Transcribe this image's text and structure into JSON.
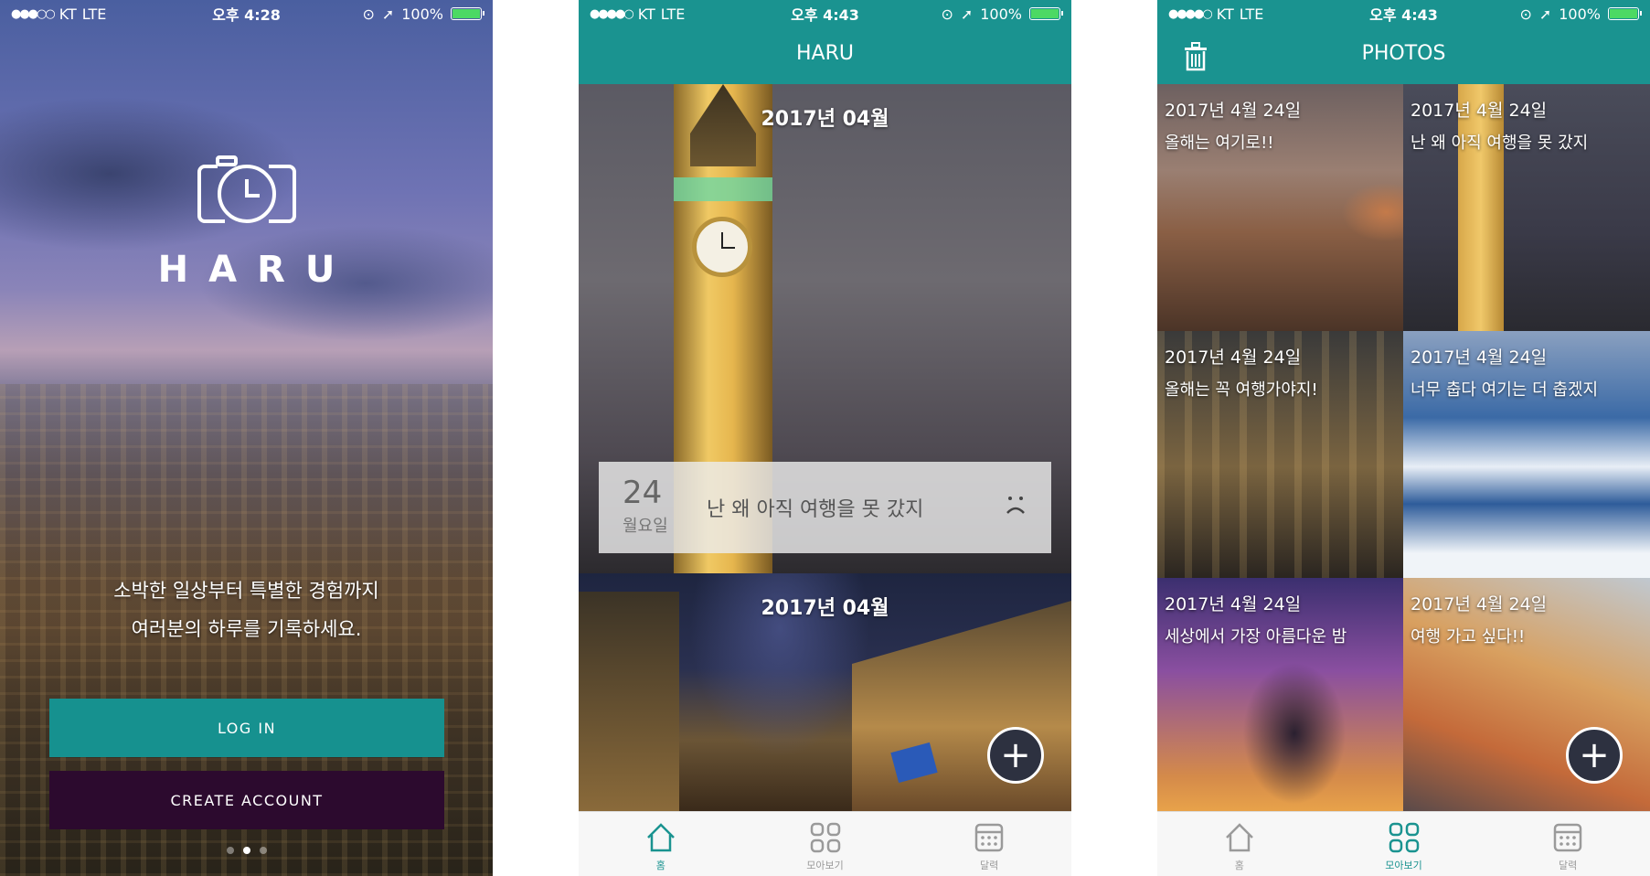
{
  "status_bars": [
    {
      "carrier": "KT",
      "network": "LTE",
      "time": "오후 4:28",
      "battery": "100%"
    },
    {
      "carrier": "KT",
      "network": "LTE",
      "time": "오후 4:43",
      "battery": "100%"
    },
    {
      "carrier": "KT",
      "network": "LTE",
      "time": "오후 4:43",
      "battery": "100%"
    }
  ],
  "welcome": {
    "logo_text": "HARU",
    "tagline_1": "소박한 일상부터 특별한 경험까지",
    "tagline_2": "여러분의 하루를 기록하세요.",
    "login_label": "LOG IN",
    "create_label": "CREATE ACCOUNT",
    "page_indicator": {
      "count": 3,
      "active_index": 1
    }
  },
  "feed": {
    "header_title": "HARU",
    "cards": [
      {
        "month": "2017년 04월",
        "day": "24",
        "weekday": "월요일",
        "text": "난 왜 아직 여행을 못 갔지",
        "mood": "sad"
      },
      {
        "month": "2017년 04월"
      }
    ],
    "fab_label": "+"
  },
  "photos": {
    "header_title": "PHOTOS",
    "items": [
      {
        "date": "2017년 4월 24일",
        "text": "올해는 여기로!!"
      },
      {
        "date": "2017년 4월 24일",
        "text": "난 왜 아직 여행을 못 갔지"
      },
      {
        "date": "2017년 4월 24일",
        "text": "올해는 꼭 여행가야지!"
      },
      {
        "date": "2017년 4월 24일",
        "text": "너무 춥다 여기는 더 춥겠지"
      },
      {
        "date": "2017년 4월 24일",
        "text": "세상에서 가장 아름다운 밤"
      },
      {
        "date": "2017년 4월 24일",
        "text": "여행 가고 싶다!!"
      }
    ],
    "fab_label": "+"
  },
  "tabs": [
    {
      "label": "홈",
      "icon": "home-icon"
    },
    {
      "label": "모아보기",
      "icon": "grid-icon"
    },
    {
      "label": "달력",
      "icon": "calendar-icon"
    }
  ],
  "tabbar_active": {
    "feed": 0,
    "photos": 1
  },
  "colors": {
    "teal": "#1a9390",
    "dark_purple": "#2c0a2e",
    "battery_green": "#4cd964"
  }
}
